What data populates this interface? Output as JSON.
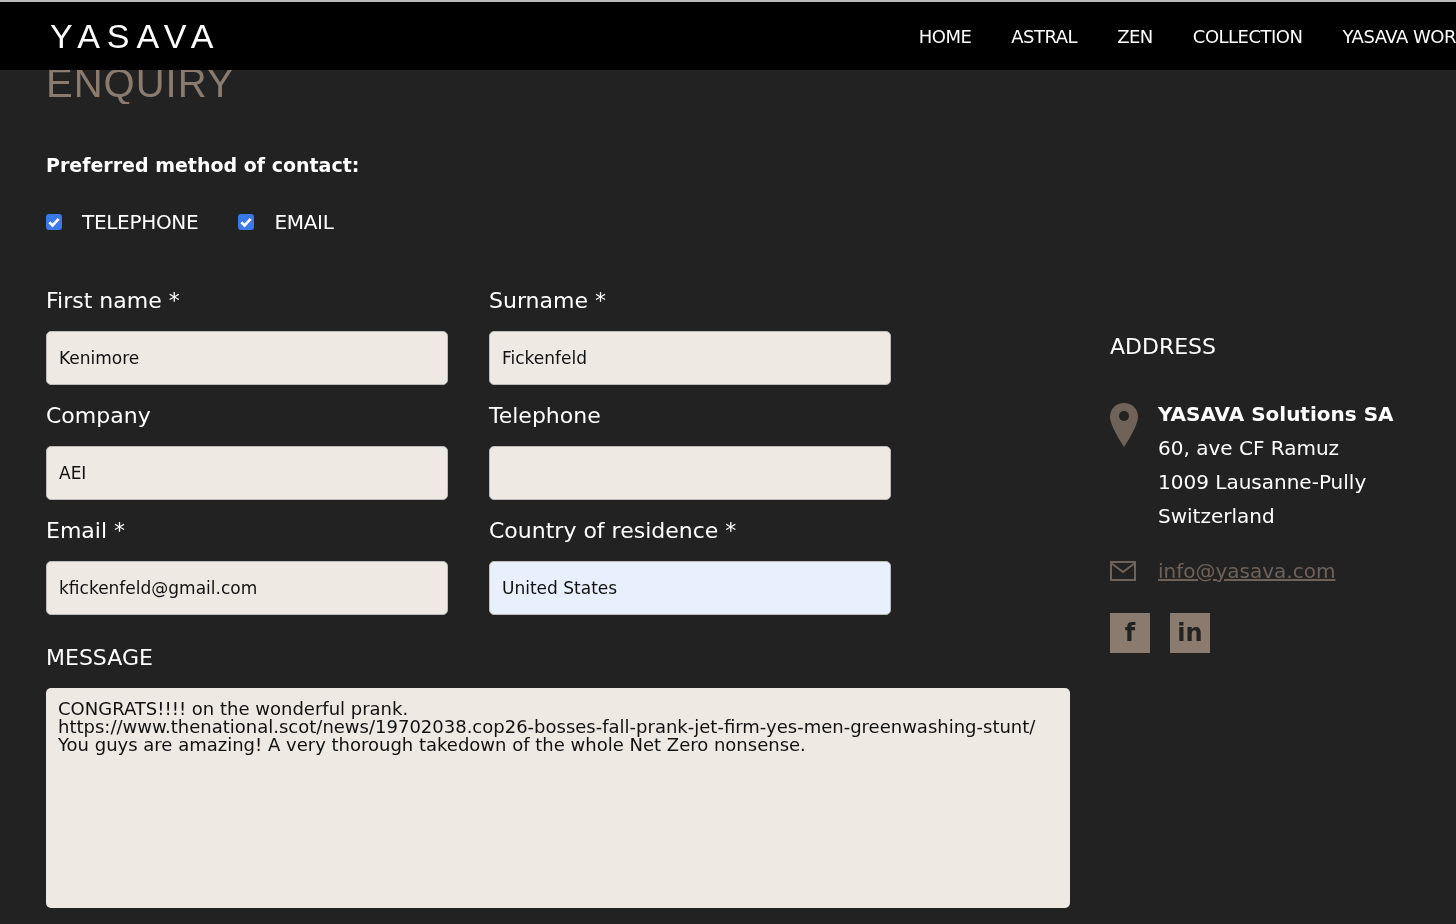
{
  "header": {
    "logo": "YASAVA",
    "nav": [
      {
        "label": "HOME"
      },
      {
        "label": "ASTRAL"
      },
      {
        "label": "ZEN"
      },
      {
        "label": "COLLECTION"
      },
      {
        "label": "YASAVA WOR"
      }
    ]
  },
  "form": {
    "title": "ENQUIRY",
    "contact_prompt": "Preferred method of contact:",
    "contact_options": [
      {
        "label": "TELEPHONE",
        "checked": true
      },
      {
        "label": "EMAIL",
        "checked": true
      }
    ],
    "fields": [
      {
        "label": "First name *",
        "value": "Kenimore",
        "highlighted": false
      },
      {
        "label": "Surname *",
        "value": "Fickenfeld",
        "highlighted": false
      },
      {
        "label": "Company",
        "value": "AEI",
        "highlighted": false
      },
      {
        "label": "Telephone",
        "highlighted": false
      },
      {
        "label": "Email *",
        "value": "kfickenfeld@gmail.com",
        "highlighted": false
      },
      {
        "label": "Country of residence *",
        "value": "United States",
        "highlighted": true
      }
    ],
    "message": {
      "label": "MESSAGE",
      "value": "CONGRATS!!!! on the wonderful prank.\nhttps://www.thenational.scot/news/19702038.cop26-bosses-fall-prank-jet-firm-yes-men-greenwashing-stunt/\nYou guys are amazing! A very thorough takedown of the whole Net Zero nonsense."
    }
  },
  "address": {
    "title": "ADDRESS",
    "company": "YASAVA Solutions SA",
    "lines": [
      "60, ave CF Ramuz",
      "1009 Lausanne-Pully",
      "Switzerland"
    ],
    "email": "info@yasava.com",
    "social": [
      {
        "label": "f"
      },
      {
        "label": "in"
      }
    ]
  }
}
